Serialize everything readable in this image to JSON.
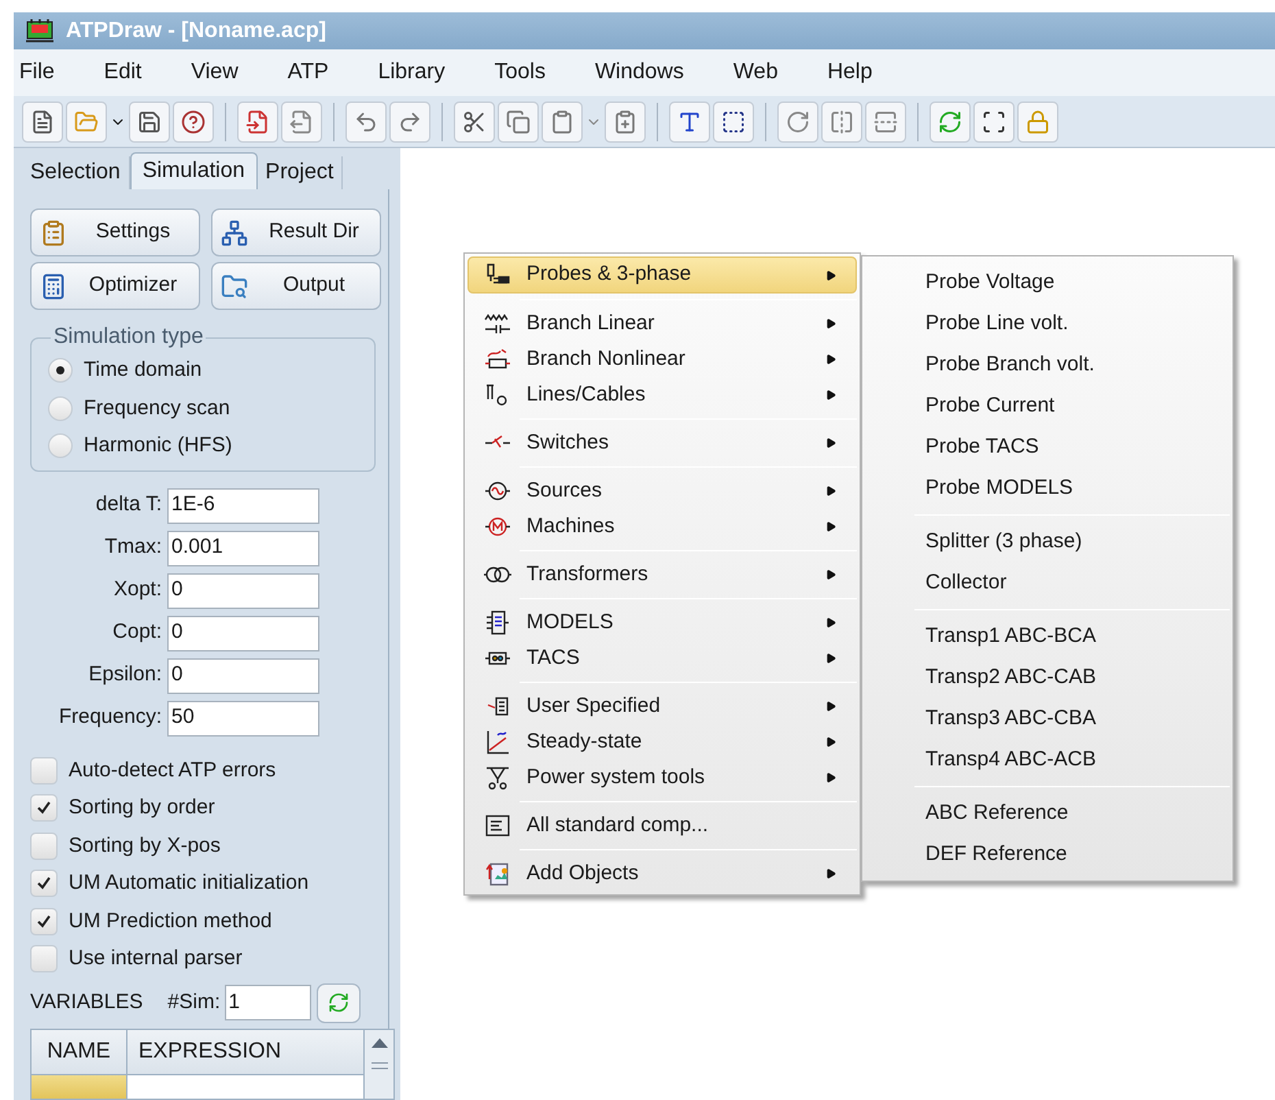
{
  "window": {
    "title": "ATPDraw - [Noname.acp]"
  },
  "menu_bar": [
    "File",
    "Edit",
    "View",
    "ATP",
    "Library",
    "Tools",
    "Windows",
    "Web",
    "Help"
  ],
  "tabs": [
    {
      "label": "Selection",
      "selected": false
    },
    {
      "label": "Simulation",
      "selected": true
    },
    {
      "label": "Project",
      "selected": false
    }
  ],
  "buttons": [
    "Settings",
    "Result Dir",
    "Optimizer",
    "Output"
  ],
  "simulation_type": {
    "title": "Simulation type",
    "options": [
      {
        "label": "Time domain",
        "selected": true
      },
      {
        "label": "Frequency scan",
        "selected": false
      },
      {
        "label": "Harmonic (HFS)",
        "selected": false
      }
    ]
  },
  "fields": [
    {
      "label": "delta T:",
      "value": "1E-6"
    },
    {
      "label": "Tmax:",
      "value": "0.001"
    },
    {
      "label": "Xopt:",
      "value": "0"
    },
    {
      "label": "Copt:",
      "value": "0"
    },
    {
      "label": "Epsilon:",
      "value": "0"
    },
    {
      "label": "Frequency:",
      "value": "50"
    }
  ],
  "checkboxes": [
    {
      "label": "Auto-detect ATP errors",
      "checked": false
    },
    {
      "label": "Sorting by order",
      "checked": true
    },
    {
      "label": "Sorting by X-pos",
      "checked": false
    },
    {
      "label": "UM Automatic initialization",
      "checked": true
    },
    {
      "label": "UM Prediction method",
      "checked": true
    },
    {
      "label": "Use internal parser",
      "checked": false
    }
  ],
  "variables": {
    "label": "VARIABLES",
    "sim_label": "#Sim:",
    "sim_value": "1"
  },
  "table": {
    "columns": [
      "NAME",
      "EXPRESSION"
    ]
  },
  "context_menu": {
    "groups": [
      [
        {
          "label": "Probes & 3-phase",
          "selected": true,
          "submenu": true
        }
      ],
      [
        {
          "label": "Branch Linear",
          "selected": false,
          "submenu": true
        },
        {
          "label": "Branch Nonlinear",
          "selected": false,
          "submenu": true
        },
        {
          "label": "Lines/Cables",
          "selected": false,
          "submenu": true
        }
      ],
      [
        {
          "label": "Switches",
          "selected": false,
          "submenu": true
        }
      ],
      [
        {
          "label": "Sources",
          "selected": false,
          "submenu": true
        },
        {
          "label": "Machines",
          "selected": false,
          "submenu": true
        }
      ],
      [
        {
          "label": "Transformers",
          "selected": false,
          "submenu": true
        }
      ],
      [
        {
          "label": "MODELS",
          "selected": false,
          "submenu": true
        },
        {
          "label": "TACS",
          "selected": false,
          "submenu": true
        }
      ],
      [
        {
          "label": "User Specified",
          "selected": false,
          "submenu": true
        },
        {
          "label": "Steady-state",
          "selected": false,
          "submenu": true
        },
        {
          "label": "Power system tools",
          "selected": false,
          "submenu": true
        }
      ],
      [
        {
          "label": "All standard comp...",
          "selected": false,
          "submenu": false
        }
      ],
      [
        {
          "label": "Add Objects",
          "selected": false,
          "submenu": true
        }
      ]
    ]
  },
  "submenu": {
    "groups": [
      [
        "Probe Voltage",
        "Probe Line volt.",
        "Probe Branch volt.",
        "Probe Current",
        "Probe TACS",
        "Probe MODELS"
      ],
      [
        "Splitter (3 phase)",
        "Collector"
      ],
      [
        "Transp1 ABC-BCA",
        "Transp2 ABC-CAB",
        "Transp3 ABC-CBA",
        "Transp4 ABC-ACB"
      ],
      [
        "ABC Reference",
        "DEF Reference"
      ]
    ]
  }
}
